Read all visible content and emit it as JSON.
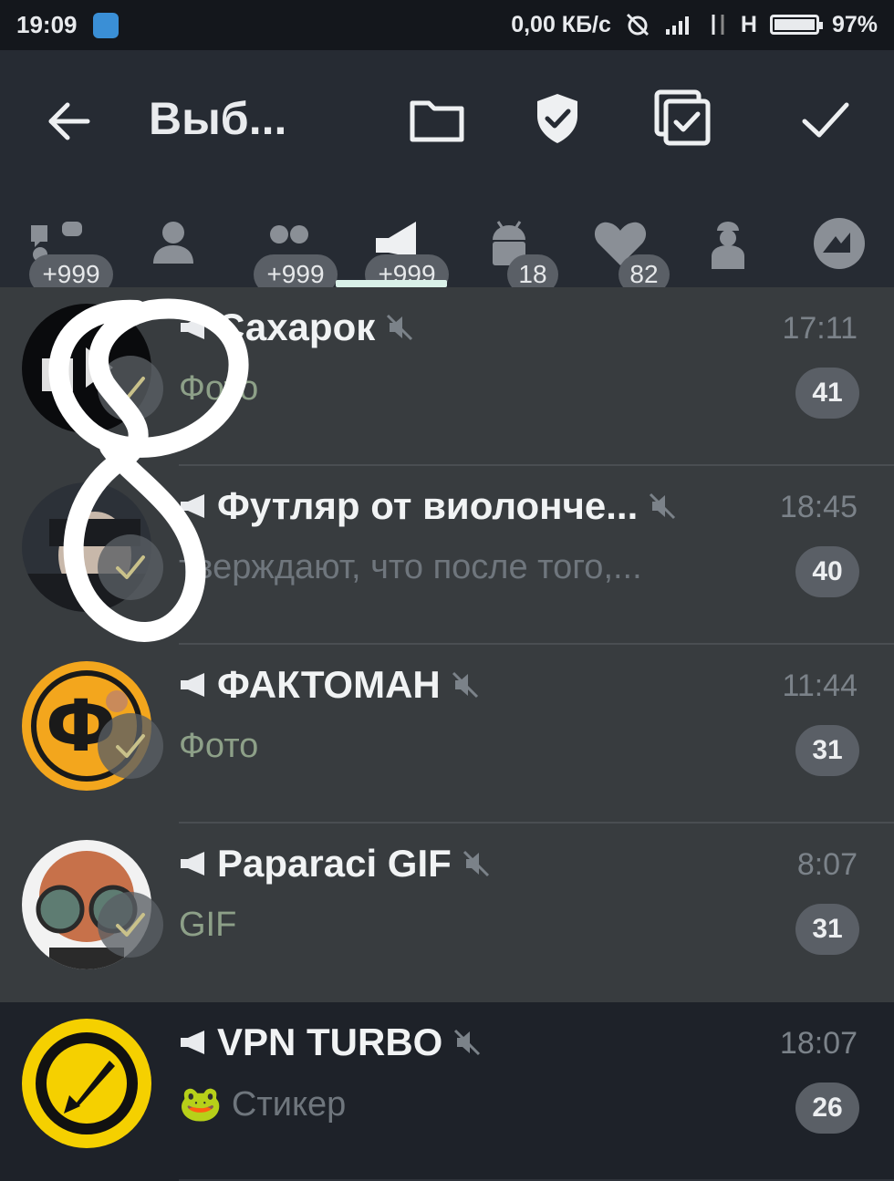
{
  "status_bar": {
    "time": "19:09",
    "speed": "0,00 КБ/с",
    "network": "H",
    "battery": "97%"
  },
  "toolbar": {
    "title": "Выб...",
    "icons": [
      "back-arrow-icon",
      "folder-icon",
      "shield-check-icon",
      "select-all-icon",
      "confirm-check-icon"
    ]
  },
  "tabs": [
    {
      "icon": "all-chats-icon",
      "badge": "+999"
    },
    {
      "icon": "person-icon",
      "badge": ""
    },
    {
      "icon": "group-icon",
      "badge": "+999"
    },
    {
      "icon": "channel-icon",
      "badge": "+999",
      "active": true
    },
    {
      "icon": "bot-icon",
      "badge": "18"
    },
    {
      "icon": "heart-icon",
      "badge": "82"
    },
    {
      "icon": "admin-icon",
      "badge": ""
    },
    {
      "icon": "custom-tab-icon",
      "badge": ""
    }
  ],
  "chats": [
    {
      "name": "Сахарок",
      "time": "17:11",
      "preview": "Фото",
      "count": "41",
      "selected": true
    },
    {
      "name": "Футляр от виолонче...",
      "time": "18:45",
      "preview": "тверждают, что после того,...",
      "count": "40",
      "selected": true
    },
    {
      "name": "ФАКТОМАН",
      "time": "11:44",
      "preview": "Фото",
      "count": "31",
      "selected": true
    },
    {
      "name": "Paparaci GIF",
      "time": "8:07",
      "preview": "GIF",
      "count": "31",
      "selected": true
    },
    {
      "name": "VPN TURBO",
      "time": "18:07",
      "preview": "🐸 Стикер",
      "count": "26",
      "selected": false
    }
  ],
  "colors": {
    "toolbar_bg": "#262b33",
    "selected_row_bg": "#383c3f",
    "badge_bg": "#5a5f66",
    "tab_indicator": "#d9f0e8"
  }
}
